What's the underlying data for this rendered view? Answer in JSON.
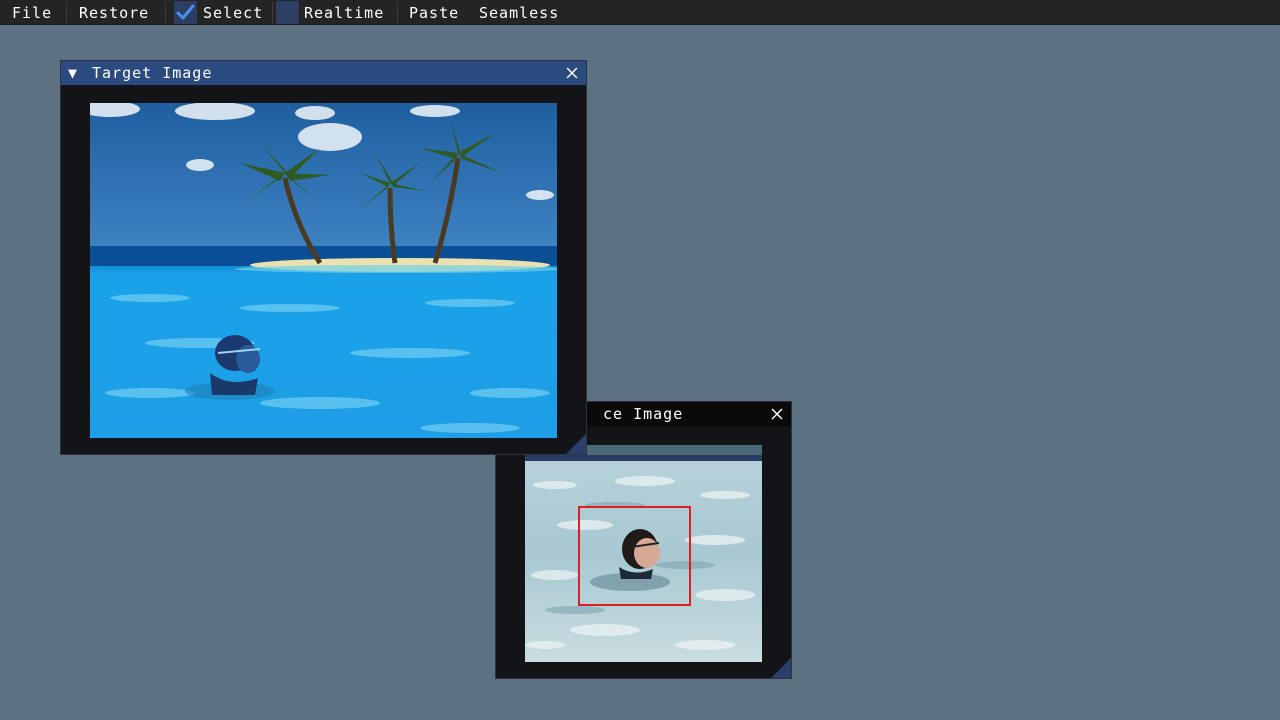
{
  "menubar": {
    "file": "File",
    "restore": "Restore",
    "select": "Select",
    "realtime": "Realtime",
    "paste": "Paste",
    "seamless": "Seamless",
    "select_checked": true,
    "realtime_checked": false
  },
  "target_window": {
    "title": "Target Image",
    "collapse_glyph": "▼"
  },
  "source_window": {
    "title": "Source Image",
    "visible_title": "ce Image"
  },
  "colors": {
    "accent": "#4b8ff0",
    "title_active": "#2a4a80",
    "title_inactive": "#0a0a0a",
    "background": "#5c7282",
    "selection_rect": "#e02020"
  }
}
